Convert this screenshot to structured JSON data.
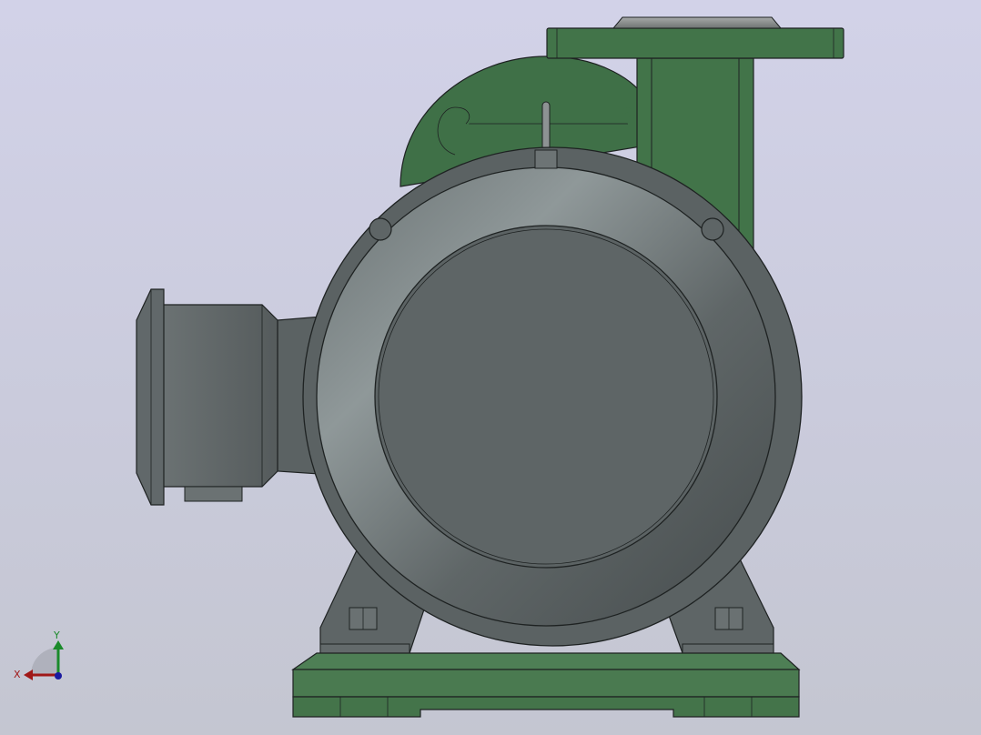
{
  "window": {
    "background_top": "#d2d2e8",
    "background_bottom": "#c4c6d1"
  },
  "model": {
    "part_colors": {
      "pump_casing": "#3f7047",
      "motor_body": "#5c6364",
      "motor_highlight": "#8b9596",
      "base": "#4c7d52",
      "edge": "#1e2222"
    }
  },
  "triad": {
    "x_label": "X",
    "y_label": "Y",
    "x_color": "#a01818",
    "y_color": "#1a8a2a",
    "z_color": "#1a1aa0"
  }
}
